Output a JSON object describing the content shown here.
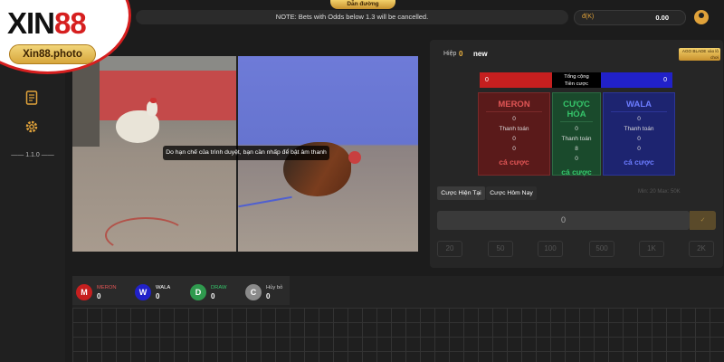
{
  "brand": {
    "logo_main": "XIN",
    "logo_num": "88",
    "site": "Xin88.photo",
    "accent": "#d61f1f"
  },
  "header": {
    "guide_label": "Dẫn đường",
    "notice": "NOTE: Bets with Odds below 1.3 will be cancelled.",
    "currency": "đ(K)",
    "balance": "0.00"
  },
  "sidebar": {
    "icons": [
      "document-icon",
      "gear-icon"
    ],
    "version": "1.1.0"
  },
  "video": {
    "subtitle": "Do hạn chế của trình duyệt, bạn cần nhấp để bật âm thanh"
  },
  "betting": {
    "round_label": "Hiệp",
    "round_value": "0",
    "round_status": "new",
    "agi_tag": "AGO BLADE vào lô chơi",
    "meron_total": "0",
    "total_label_1": "Tổng cộng",
    "total_label_2": "Tiền cược",
    "wala_total": "0",
    "cards": [
      {
        "name": "MERON",
        "v1": "0",
        "payout_label": "Thanh toán",
        "v2": "0",
        "v3": "0",
        "cta": "cá cược"
      },
      {
        "name": "CƯỢC HÒA",
        "v1": "0",
        "payout_label": "Thanh toán",
        "v2": "8",
        "v3": "0",
        "cta": "cá cược"
      },
      {
        "name": "WALA",
        "v1": "0",
        "payout_label": "Thanh toán",
        "v2": "0",
        "v3": "0",
        "cta": "cá cược"
      }
    ],
    "tab_current": "Cược Hiện Tại",
    "tab_today": "Cược Hôm Nay",
    "min_max": "Min: 20  Max: 50K",
    "amount_value": "0",
    "chips": [
      "20",
      "50",
      "100",
      "500",
      "1K",
      "2K"
    ]
  },
  "results": {
    "items": [
      {
        "letter": "M",
        "label": "MERON",
        "count": "0",
        "color": "#c61f1f",
        "label_color": "#e05555"
      },
      {
        "letter": "W",
        "label": "WALA",
        "count": "0",
        "color": "#2121c9",
        "label_color": "#ffffff"
      },
      {
        "letter": "D",
        "label": "DRAW",
        "count": "0",
        "color": "#2f9a4e",
        "label_color": "#35c46a"
      },
      {
        "letter": "C",
        "label": "Hủy bỏ",
        "count": "0",
        "color": "#8a8a8a",
        "label_color": "#cccccc"
      }
    ]
  }
}
